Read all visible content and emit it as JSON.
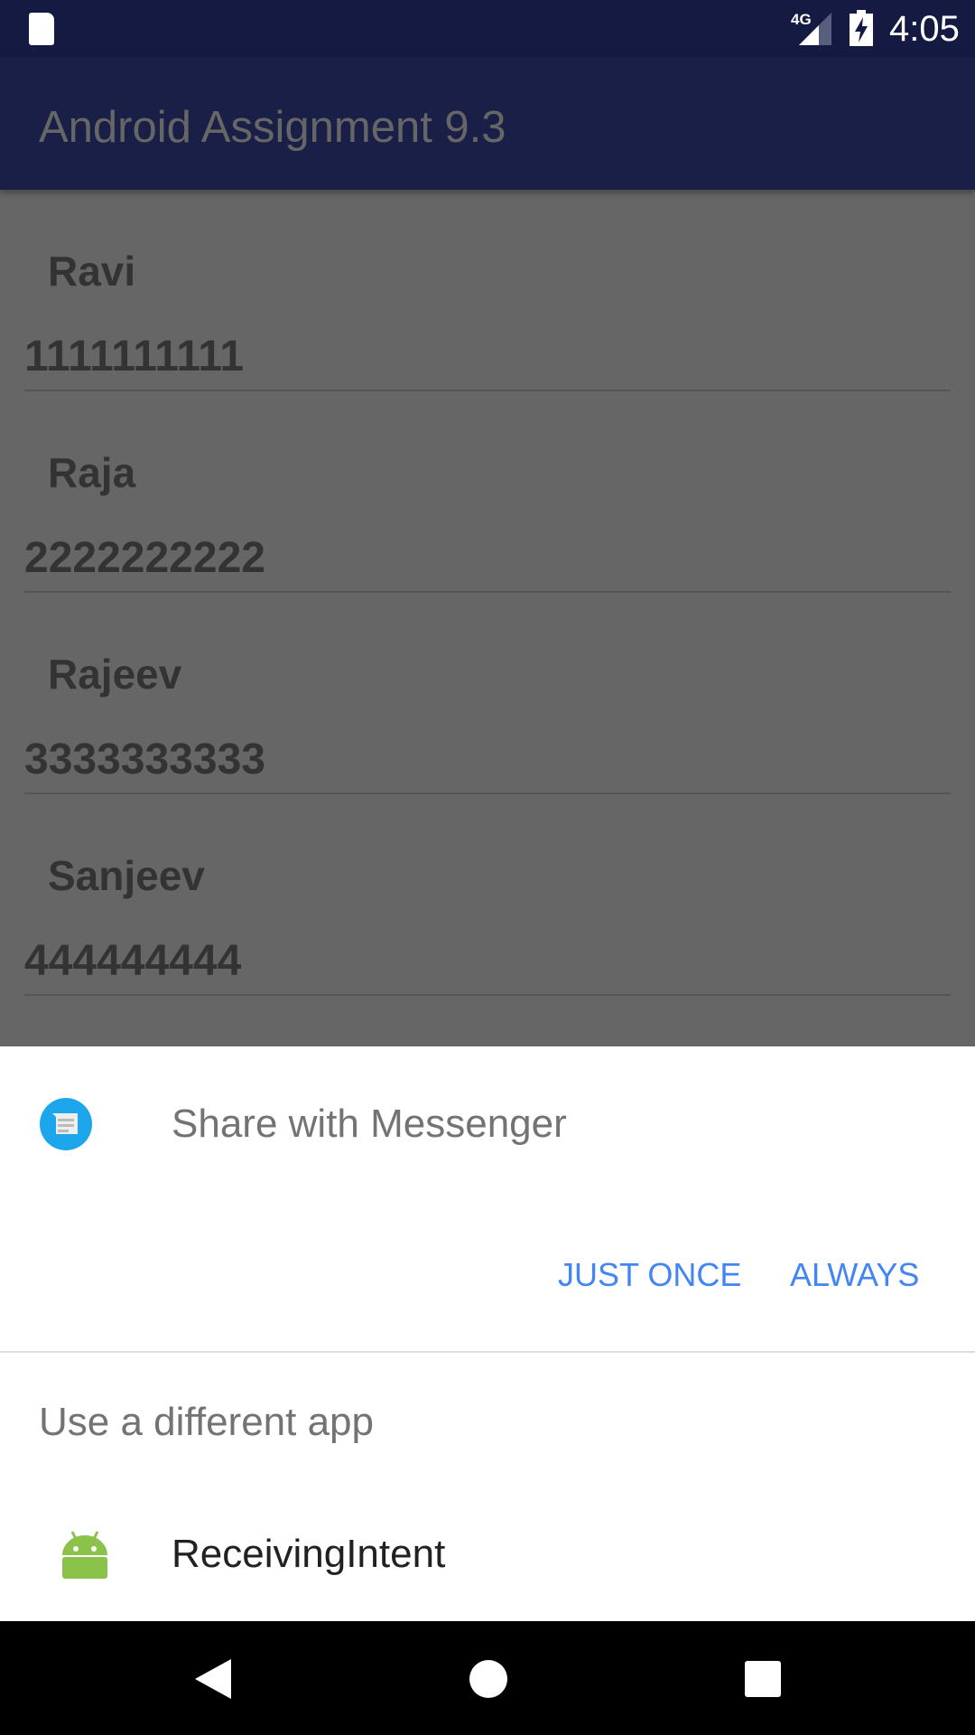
{
  "status_bar": {
    "time": "4:05",
    "network": "4G"
  },
  "app_bar": {
    "title": "Android Assignment 9.3"
  },
  "contacts": [
    {
      "name": "Ravi",
      "number": "1111111111"
    },
    {
      "name": "Raja",
      "number": "2222222222"
    },
    {
      "name": "Rajeev",
      "number": "3333333333"
    },
    {
      "name": "Sanjeev",
      "number": "444444444"
    }
  ],
  "chooser": {
    "default_app_label": "Share with Messenger",
    "just_once": "JUST ONCE",
    "always": "ALWAYS",
    "other_header": "Use a different app",
    "apps": [
      {
        "label": "ReceivingIntent"
      }
    ]
  },
  "colors": {
    "accent": "#4285f4",
    "status_bar": "#151a42",
    "app_bar": "#1a1f48"
  }
}
